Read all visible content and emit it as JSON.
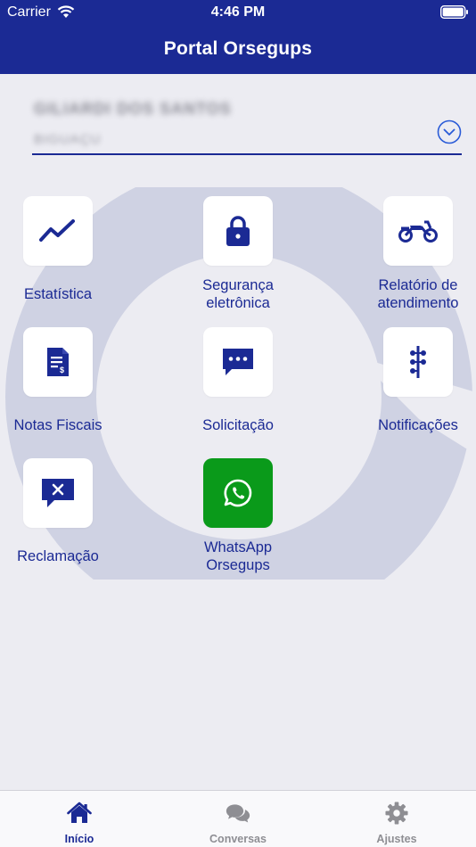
{
  "status_bar": {
    "carrier": "Carrier",
    "time": "4:46 PM"
  },
  "header": {
    "title": "Portal Orsegups"
  },
  "account": {
    "name": "GILIARDI DOS SANTOS",
    "subtitle": "BIGUAÇU"
  },
  "tiles": [
    {
      "label": "Estatística",
      "icon": "trend-line-icon"
    },
    {
      "label_line1": "Segurança",
      "label_line2": "eletrônica",
      "icon": "lock-icon"
    },
    {
      "label_line1": "Relatório de",
      "label_line2": "atendimento",
      "icon": "motorcycle-icon"
    },
    {
      "label": "Notas Fiscais",
      "icon": "invoice-icon"
    },
    {
      "label": "Solicitação",
      "icon": "chat-dots-icon"
    },
    {
      "label": "Notificações",
      "icon": "timeline-icon"
    },
    {
      "label": "Reclamação",
      "icon": "chat-x-icon"
    },
    {
      "label_line1": "WhatsApp",
      "label_line2": "Orsegups",
      "icon": "whatsapp-icon"
    }
  ],
  "tabbar": {
    "tabs": [
      {
        "label": "Início",
        "icon": "home-icon",
        "active": true
      },
      {
        "label": "Conversas",
        "icon": "chat-bubbles-icon",
        "active": false
      },
      {
        "label": "Ajustes",
        "icon": "gear-icon",
        "active": false
      }
    ]
  },
  "colors": {
    "primary": "#1b2a94",
    "whatsapp": "#0a9a1a",
    "background": "#ececf2"
  }
}
